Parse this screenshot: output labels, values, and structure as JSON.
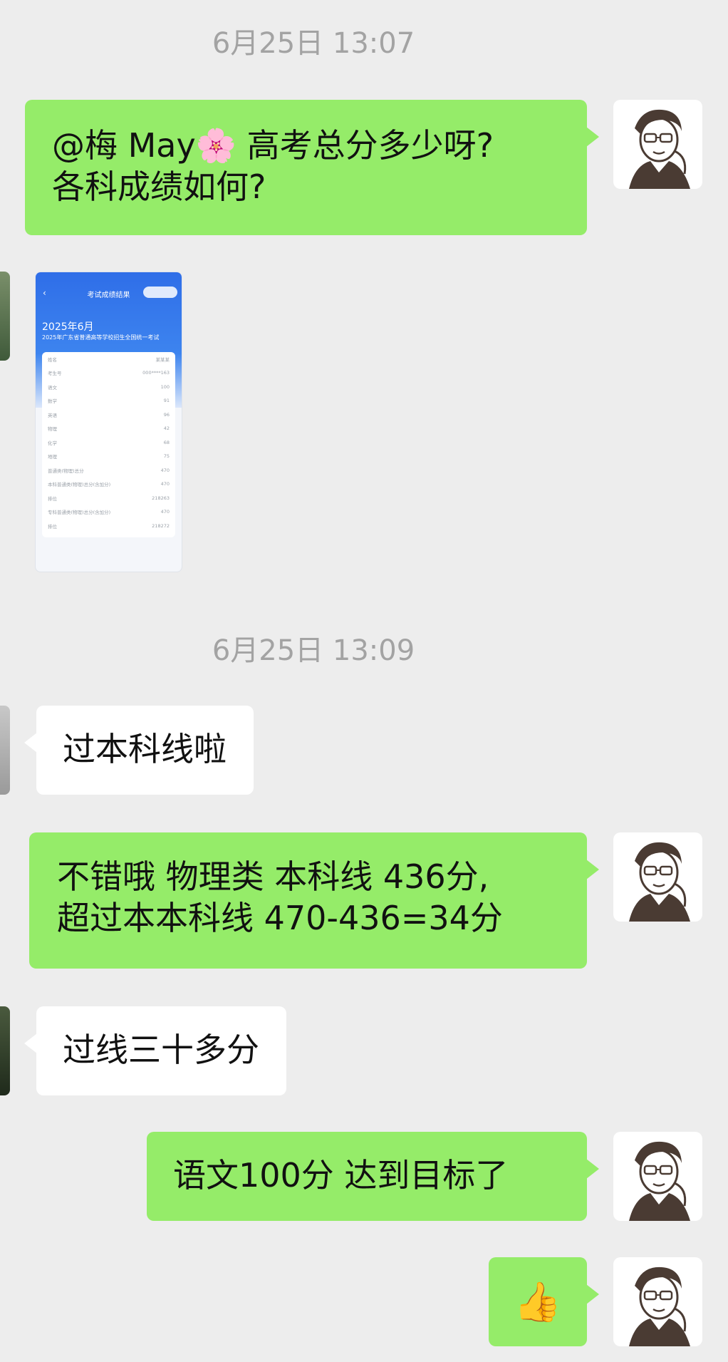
{
  "timestamps": [
    "6月25日 13:07",
    "6月25日 13:09"
  ],
  "messages": {
    "m1": {
      "sender": "me",
      "line1": "@梅 May🌸  高考总分多少呀?",
      "line2": "各科成绩如何?"
    },
    "m2": {
      "sender": "other",
      "type": "image"
    },
    "m3": {
      "sender": "other",
      "text": "过本科线啦"
    },
    "m4": {
      "sender": "me",
      "line1": "不错哦 物理类 本科线 436分,",
      "line2": "超过本本科线 470-436=34分"
    },
    "m5": {
      "sender": "other",
      "text": "过线三十多分"
    },
    "m6": {
      "sender": "me",
      "text": "语文100分 达到目标了"
    },
    "m7": {
      "sender": "me",
      "text": "👍"
    }
  },
  "score_screenshot": {
    "header": "考试成绩结果",
    "month": "2025年6月",
    "exam": "2025年广东省普通高等学校招生全国统一考试",
    "rows": [
      {
        "label": "姓名",
        "value": "某某某"
      },
      {
        "label": "考生号",
        "value": "000****163"
      },
      {
        "label": "语文",
        "value": "100"
      },
      {
        "label": "数学",
        "value": "91"
      },
      {
        "label": "英语",
        "value": "96"
      },
      {
        "label": "物理",
        "value": "42"
      },
      {
        "label": "化学",
        "value": "68"
      },
      {
        "label": "地理",
        "value": "75"
      },
      {
        "label": "普通类(物理)总分",
        "value": "470"
      },
      {
        "label": "本科普通类(物理)总分(含加分)",
        "value": "470"
      },
      {
        "label": "排位",
        "value": "218263"
      },
      {
        "label": "专科普通类(物理)总分(含加分)",
        "value": "470"
      },
      {
        "label": "排位",
        "value": "218272"
      }
    ]
  },
  "colors": {
    "background": "#ededed",
    "my_bubble": "#95ec69",
    "other_bubble": "#ffffff",
    "timestamp": "#a3a3a3"
  }
}
